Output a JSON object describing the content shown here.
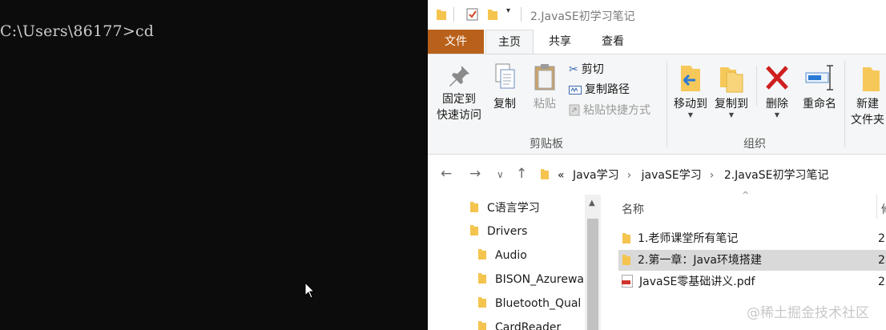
{
  "console": {
    "prompt": "C:\\Users\\86177>cd"
  },
  "explorer": {
    "title": "2.JavaSE初学习笔记",
    "tabs": {
      "file": "文件",
      "home": "主页",
      "share": "共享",
      "view": "查看"
    },
    "ribbon": {
      "pin_label_1": "固定到",
      "pin_label_2": "快速访问",
      "copy": "复制",
      "paste": "粘贴",
      "cut": "剪切",
      "copy_path": "复制路径",
      "paste_shortcut": "粘贴快捷方式",
      "clipboard_group": "剪贴板",
      "move_to": "移动到",
      "copy_to": "复制到",
      "delete": "删除",
      "rename": "重命名",
      "organize_group": "组织",
      "new_folder_1": "新建",
      "new_folder_2": "文件夹"
    },
    "breadcrumb": {
      "overflow": "«",
      "parts": [
        "Java学习",
        "javaSE学习",
        "2.JavaSE初学习笔记"
      ]
    },
    "tree": [
      "C语言学习",
      "Drivers",
      "Audio",
      "BISON_Azurewa",
      "Bluetooth_Qual",
      "CardReader"
    ],
    "columns": {
      "name": "名称",
      "next": "修"
    },
    "files": [
      {
        "name": "1.老师课堂所有笔记",
        "date": "2",
        "type": "folder"
      },
      {
        "name": "2.第一章：Java环境搭建",
        "date": "2",
        "type": "folder"
      },
      {
        "name": "JavaSE零基础讲义.pdf",
        "date": "2",
        "type": "pdf"
      }
    ]
  },
  "watermark": "@稀土掘金技术社区"
}
